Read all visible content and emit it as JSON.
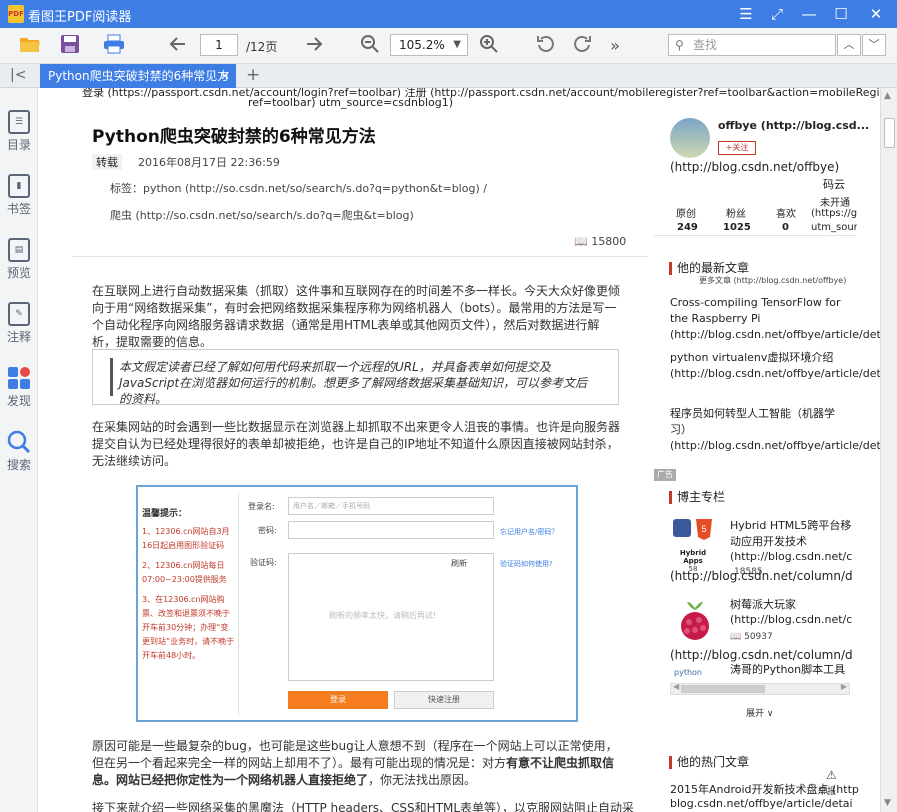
{
  "window": {
    "title": "看图王PDF阅读器",
    "logo_text": "PDF",
    "controls": {
      "menu": "☰",
      "expand": "⤢",
      "minimize": "—",
      "maximize": "☐",
      "close": "✕"
    }
  },
  "toolbar": {
    "open_icon": "folder-open-icon",
    "save_icon": "save-icon",
    "print_icon": "print-icon",
    "prev_icon": "arrow-left-icon",
    "current_page": "1",
    "total_pages": "/12页",
    "next_icon": "arrow-right-icon",
    "zoom_value": "105.2%",
    "more": "»",
    "search_placeholder": "查找"
  },
  "tabs": [
    {
      "label": "Python爬虫突破封禁的6种常见方"
    }
  ],
  "sidebar": {
    "items": [
      {
        "label": "目录",
        "icon": "toc-icon"
      },
      {
        "label": "书签",
        "icon": "bookmark-icon"
      },
      {
        "label": "预览",
        "icon": "preview-icon"
      },
      {
        "label": "注释",
        "icon": "annotation-icon"
      },
      {
        "label": "发现",
        "icon": "discover-icon"
      },
      {
        "label": "搜索",
        "icon": "search-icon"
      }
    ]
  },
  "article": {
    "top_line": "登录 (https://passport.csdn.net/account/login?ref=toolbar)   注册 (http://passport.csdn.net/account/mobileregister?ref=toolbar&action=mobileRegister)",
    "top_line2": "ref=toolbar)   utm_source=csdnblog1)",
    "title": "Python爬虫突破封禁的6种常见方法",
    "tag_type": "转载",
    "date": "2016年08月17日 22:36:59",
    "tags_line1": "标签：python (http://so.csdn.net/so/search/s.do?q=python&t=blog)  /",
    "tags_line2": "爬虫 (http://so.csdn.net/so/search/s.do?q=爬虫&t=blog)",
    "views": "15800",
    "para1": "在互联网上进行自动数据采集（抓取）这件事和互联网存在的时间差不多一样长。今天大众好像更倾向于用“网络数据采集”，有时会把网络数据采集程序称为网络机器人（bots）。最常用的方法是写一个自动化程序向网络服务器请求数据（通常是用HTML表单或其他网页文件），然后对数据进行解析，提取需要的信息。",
    "quote": "本文假定读者已经了解如何用代码来抓取一个远程的URL，并具备表单如何提交及JavaScript在浏览器如何运行的机制。想更多了解网络数据采集基础知识，可以参考文后的资料。",
    "para2": "在采集网站的时会遇到一些比数据显示在浏览器上却抓取不出来更令人沮丧的事情。也许是向服务器提交自认为已经处理得很好的表单却被拒绝，也许是自己的IP地址不知道什么原因直接被网站封杀，无法继续访问。",
    "para3_a": "原因可能是一些最复杂的bug，也可能是这些bug让人意想不到（程序在一个网站上可以正常使用，但在另一个看起来完全一样的网站上却用不了）。最有可能出现的情况是：对方",
    "para3_b": "有意不让爬虫抓取信息。网站已经把你定性为一个网络机器人直接拒绝了",
    "para3_c": "，你无法找出原因。",
    "para4": "接下来就介绍一些网络采集的黑魔法（HTTP headers、CSS和HTML表单等），以克服网站阻止自动采"
  },
  "screenshot_form": {
    "tips_title": "温馨提示：",
    "tips": [
      "1、12306.cn网站自3月16日起启用图形验证码",
      "2、12306.cn网站每日07:00~23:00提供服务",
      "3、在12306.cn网站购票、改签和退票须不晚于开车前30分钟；办理“变更到站”业务时，请不晚于开车前48小时。"
    ],
    "username_label": "登录名:",
    "username_placeholder": "用户名／邮箱／手机号码",
    "password_label": "密码:",
    "forgot_link": "忘记用户名/密码？",
    "captcha_label": "验证码:",
    "captcha_help_link": "验证码如何使用?",
    "refresh": "刷新",
    "captcha_msg": "刷新的频率太快，请稍后再试!",
    "login_btn": "登录",
    "register_btn": "快速注册"
  },
  "right_panel": {
    "author": "offbye (http://blog.csd...",
    "author_link": "(http://blog.csdn.net/offbye)",
    "follow": "+关注",
    "codecloud": "码云",
    "stats": [
      {
        "label": "原创",
        "value": "249"
      },
      {
        "label": "粉丝",
        "value": "1025"
      },
      {
        "label": "喜欢",
        "value": "0"
      }
    ],
    "not_open": "未开通",
    "not_open_link1": "(https://gi",
    "not_open_link2": "utm_sourc",
    "latest_title": "他的最新文章",
    "more_articles": "更多文章 (http://blog.csdn.net/offbye)",
    "latest": [
      "Cross-compiling TensorFlow for the Raspberry Pi (http://blog.csdn.net/offbye/article/details/78669587)",
      "python virtualenv虚拟环境介绍 (http://blog.csdn.net/offbye/article/details/78669553)",
      "程序员如何转型人工智能（机器学习）(http://blog.csdn.net/offbye/article/details/78515793)"
    ],
    "ad": "广告",
    "columns_title": "博主专栏",
    "col1_title": "Hybrid HTML5跨平台移动应用开发技术",
    "col1_link": "(http://blog.csdn.net/colu",
    "col1_link2": "(http://blog.csdn.net/column/deta",
    "col1_img": "Hybrid Apps",
    "col1_img_count": "58",
    "col1_views": "18585",
    "col2_title": "树莓派大玩家",
    "col2_link": "(http://blog.csdn.net/colu",
    "col2_views": "50937",
    "col2_link2": "(http://blog.csdn.net/column/deta",
    "col3_img": "python",
    "col3_title": "涛哥的Python脚本工具箱",
    "expand": "展开",
    "hot_title": "他的热门文章",
    "hot1_title": "2015年Android开发新技术盘点 (http://",
    "hot1_link": "blog.csdn.net/offbye/article/details/50",
    "report": "举报"
  }
}
